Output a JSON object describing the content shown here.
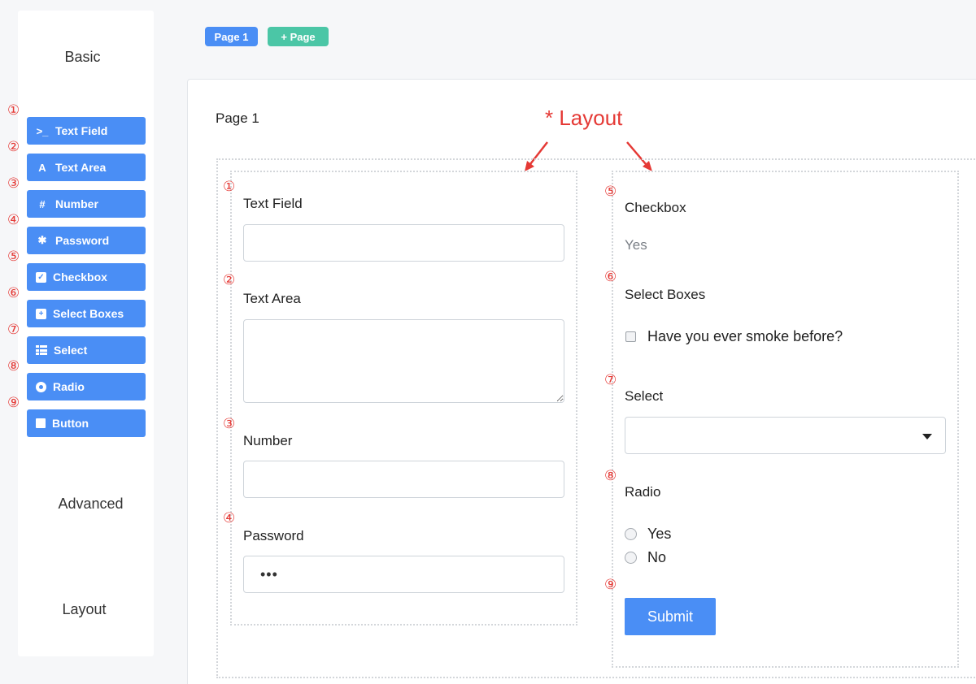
{
  "sidebar": {
    "groups": {
      "basic": "Basic",
      "advanced": "Advanced",
      "layout": "Layout"
    },
    "components": [
      {
        "num": "①",
        "label": "Text Field",
        "icon": "terminal-icon"
      },
      {
        "num": "②",
        "label": "Text Area",
        "icon": "font-icon"
      },
      {
        "num": "③",
        "label": "Number",
        "icon": "hash-icon"
      },
      {
        "num": "④",
        "label": "Password",
        "icon": "asterisk-icon"
      },
      {
        "num": "⑤",
        "label": "Checkbox",
        "icon": "check-square-icon"
      },
      {
        "num": "⑥",
        "label": "Select Boxes",
        "icon": "plus-square-icon"
      },
      {
        "num": "⑦",
        "label": "Select",
        "icon": "th-list-icon"
      },
      {
        "num": "⑧",
        "label": "Radio",
        "icon": "dot-circle-icon"
      },
      {
        "num": "⑨",
        "label": "Button",
        "icon": "stop-icon"
      }
    ],
    "icon_glyphs": {
      "terminal": ">_",
      "font": "A",
      "hash": "#",
      "asterisk": "✱",
      "check": "✓",
      "plus": "+"
    }
  },
  "tabs": {
    "page1": "Page 1",
    "add": "+ Page"
  },
  "main": {
    "page_title": "Page 1",
    "annotation": "* Layout",
    "left": {
      "text_field": {
        "num": "①",
        "label": "Text Field",
        "value": ""
      },
      "text_area": {
        "num": "②",
        "label": "Text Area",
        "value": ""
      },
      "number": {
        "num": "③",
        "label": "Number",
        "value": ""
      },
      "password": {
        "num": "④",
        "label": "Password",
        "value": "•••"
      }
    },
    "right": {
      "checkbox": {
        "num": "⑤",
        "label": "Checkbox",
        "value_text": "Yes"
      },
      "select_boxes": {
        "num": "⑥",
        "label": "Select Boxes",
        "option": "Have you ever smoke before?"
      },
      "select": {
        "num": "⑦",
        "label": "Select",
        "value": ""
      },
      "radio": {
        "num": "⑧",
        "label": "Radio",
        "options": [
          "Yes",
          "No"
        ]
      },
      "button": {
        "num": "⑨",
        "label": "Submit"
      }
    }
  },
  "colors": {
    "primary": "#4a8ef5",
    "add_tab": "#4bc6a6",
    "annotation": "#e53935"
  }
}
